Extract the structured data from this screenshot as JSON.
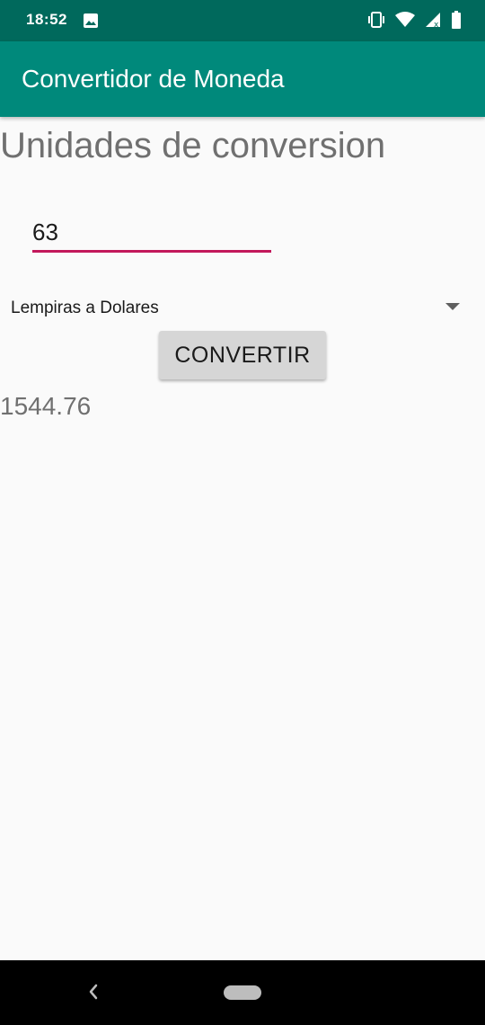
{
  "status_bar": {
    "time": "18:52",
    "icons": [
      "gallery-icon",
      "vibrate-icon",
      "wifi-icon",
      "signal-icon",
      "battery-icon"
    ]
  },
  "app_bar": {
    "title": "Convertidor de Moneda"
  },
  "main": {
    "heading": "Unidades de conversion",
    "amount_value": "63",
    "conversion_selected": "Lempiras a Dolares",
    "convert_button_label": "CONVERTIR",
    "result": "1544.76"
  },
  "nav_bar": {
    "icons": [
      "back-icon",
      "home-pill-icon"
    ]
  },
  "colors": {
    "status_bar": "#00695c",
    "app_bar": "#00897b",
    "input_underline": "#c2185b",
    "button": "#d6d6d6",
    "background": "#fafafa"
  }
}
